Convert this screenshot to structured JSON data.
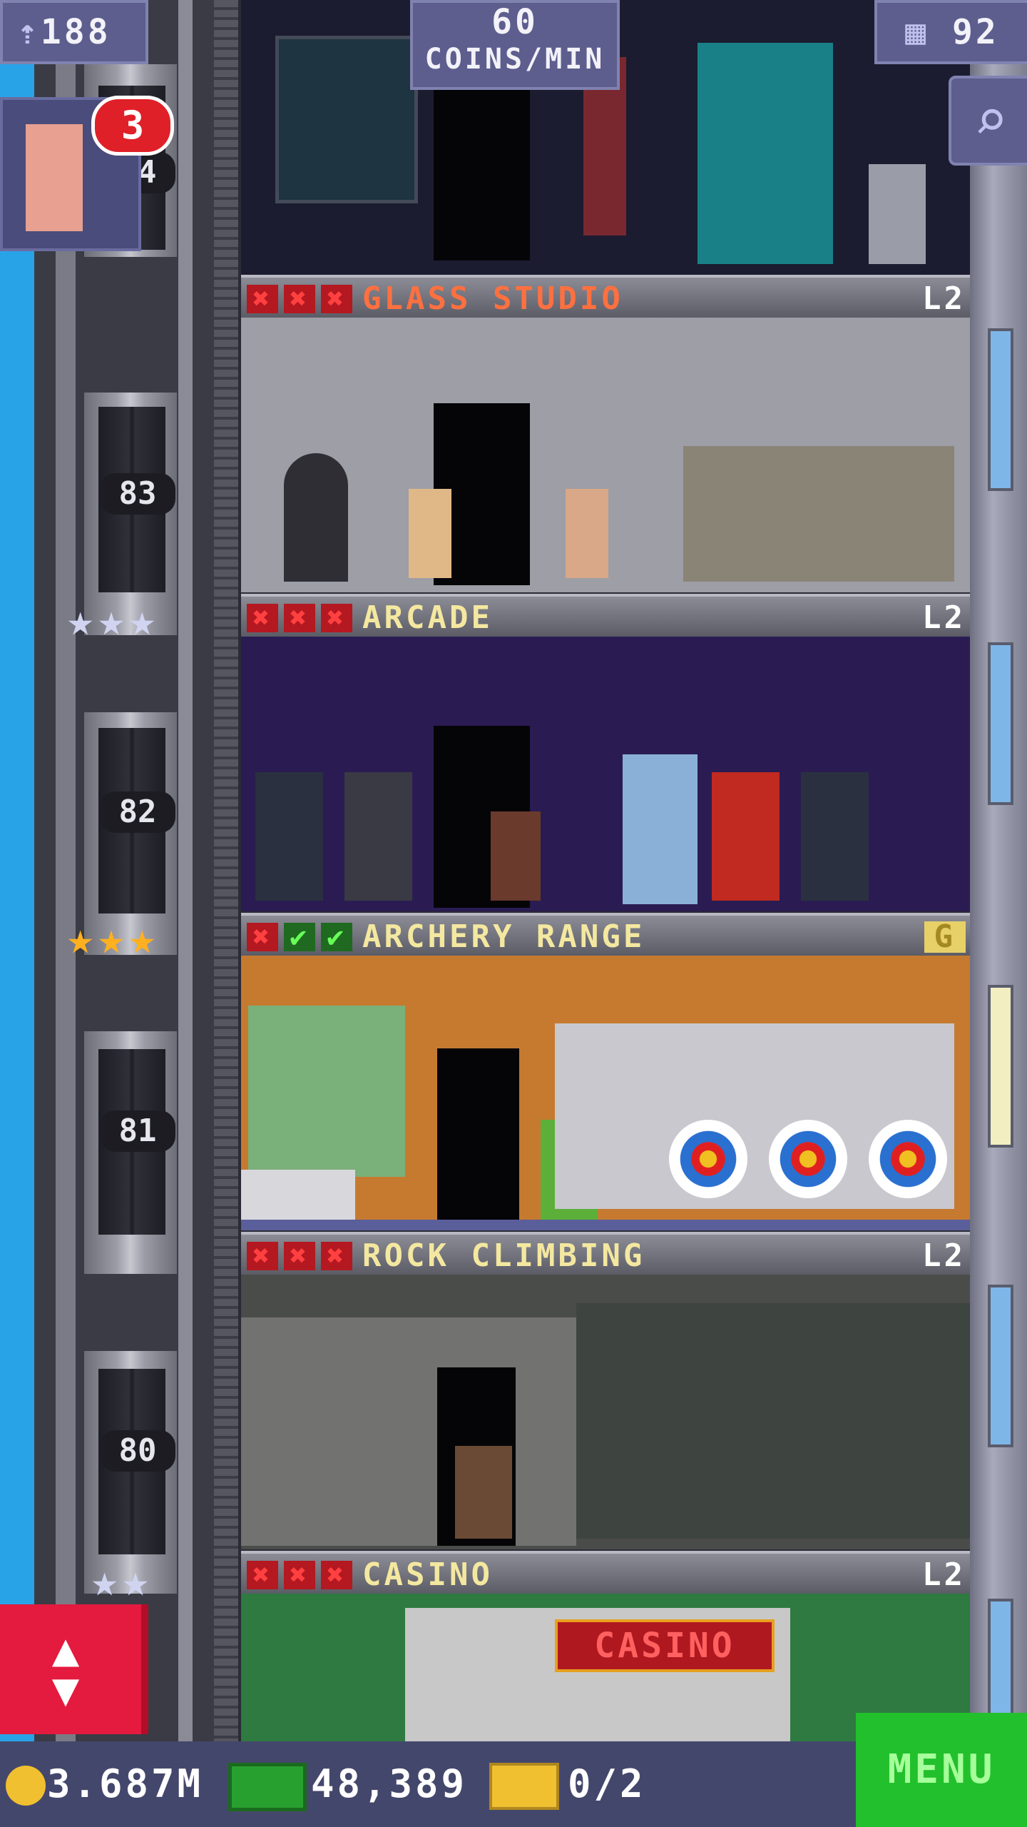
{
  "hud": {
    "population": "188",
    "coins_rate_value": "60",
    "coins_rate_unit": "COINS/MIN",
    "floors_count": "92",
    "notification_count": "3"
  },
  "floors": [
    {
      "name": "GLASS STUDIO",
      "level": "L2",
      "name_color": "#ff7040",
      "marks": [
        "x",
        "x",
        "x"
      ]
    },
    {
      "name": "ARCADE",
      "level": "L2",
      "name_color": "#f4e8a0",
      "marks": [
        "x",
        "x",
        "x"
      ]
    },
    {
      "name": "ARCHERY RANGE",
      "level": "G",
      "name_color": "#f4e8a0",
      "marks": [
        "x",
        "ok",
        "ok"
      ]
    },
    {
      "name": "ROCK CLIMBING",
      "level": "L2",
      "name_color": "#f4e8a0",
      "marks": [
        "x",
        "x",
        "x"
      ]
    },
    {
      "name": "CASINO",
      "level": "L2",
      "name_color": "#f4e8a0",
      "marks": [
        "x",
        "x",
        "x"
      ]
    }
  ],
  "elevator": {
    "floor_numbers": [
      "84",
      "83",
      "82",
      "81",
      "80"
    ]
  },
  "casino_sign": "CASINO",
  "bottom_bar": {
    "coins": "3.687M",
    "bux": "48,389",
    "tickets": "0/2",
    "menu_label": "MENU"
  },
  "colors": {
    "x_mark": "#ff4040",
    "check_mark": "#68ff58",
    "menu_green": "#22c02c",
    "elevator_button": "#e41a3e"
  },
  "icons": [
    "population-icon",
    "floors-icon",
    "search-icon",
    "coin-icon",
    "bux-icon",
    "ticket-icon",
    "elevator-arrows-icon"
  ]
}
